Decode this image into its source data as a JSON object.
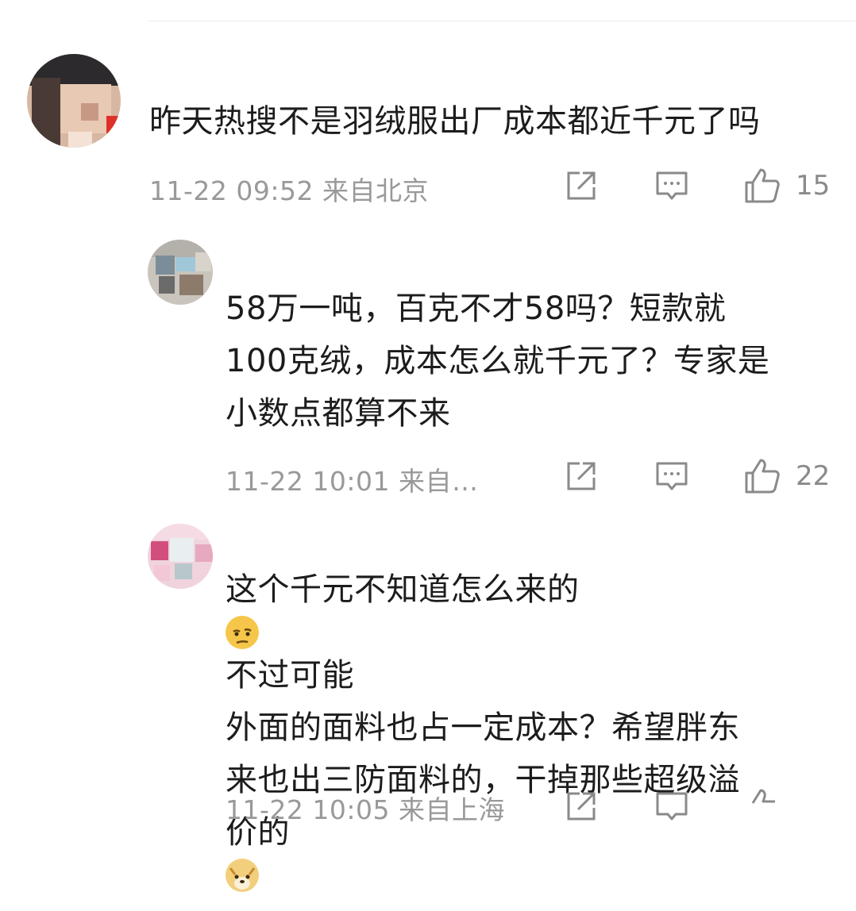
{
  "comments": [
    {
      "username": "",
      "text_lines": [
        "昨天热搜不是羽绒服出厂成本都近千元了吗"
      ],
      "meta": "11-22 09:52 来自北京",
      "like_count": "15"
    },
    {
      "username": "",
      "text_lines": [
        "58万一吨，百克不才58吗？短款就",
        "100克绒，成本怎么就千元了？专家是",
        "小数点都算不来"
      ],
      "meta": "11-22 10:01 来自…",
      "like_count": "22"
    },
    {
      "username": "",
      "text_lines_a": "这个千元不知道怎么来的",
      "text_lines_b": "不过可能",
      "text_line2": "外面的面料也占一定成本？希望胖东",
      "text_line3": "来也出三防面料的，干掉那些超级溢",
      "text_line4": "价的",
      "meta": "11-22 10:05 来自上海"
    }
  ],
  "icons": {
    "share": "share-icon",
    "comment": "comment-icon",
    "like": "thumbs-up-icon",
    "emoji_thinking": "thinking-face-emoji",
    "emoji_doge": "doge-emoji"
  },
  "colors": {
    "text": "#1c1c1c",
    "meta": "#999999",
    "icon": "#8a8a8a"
  }
}
